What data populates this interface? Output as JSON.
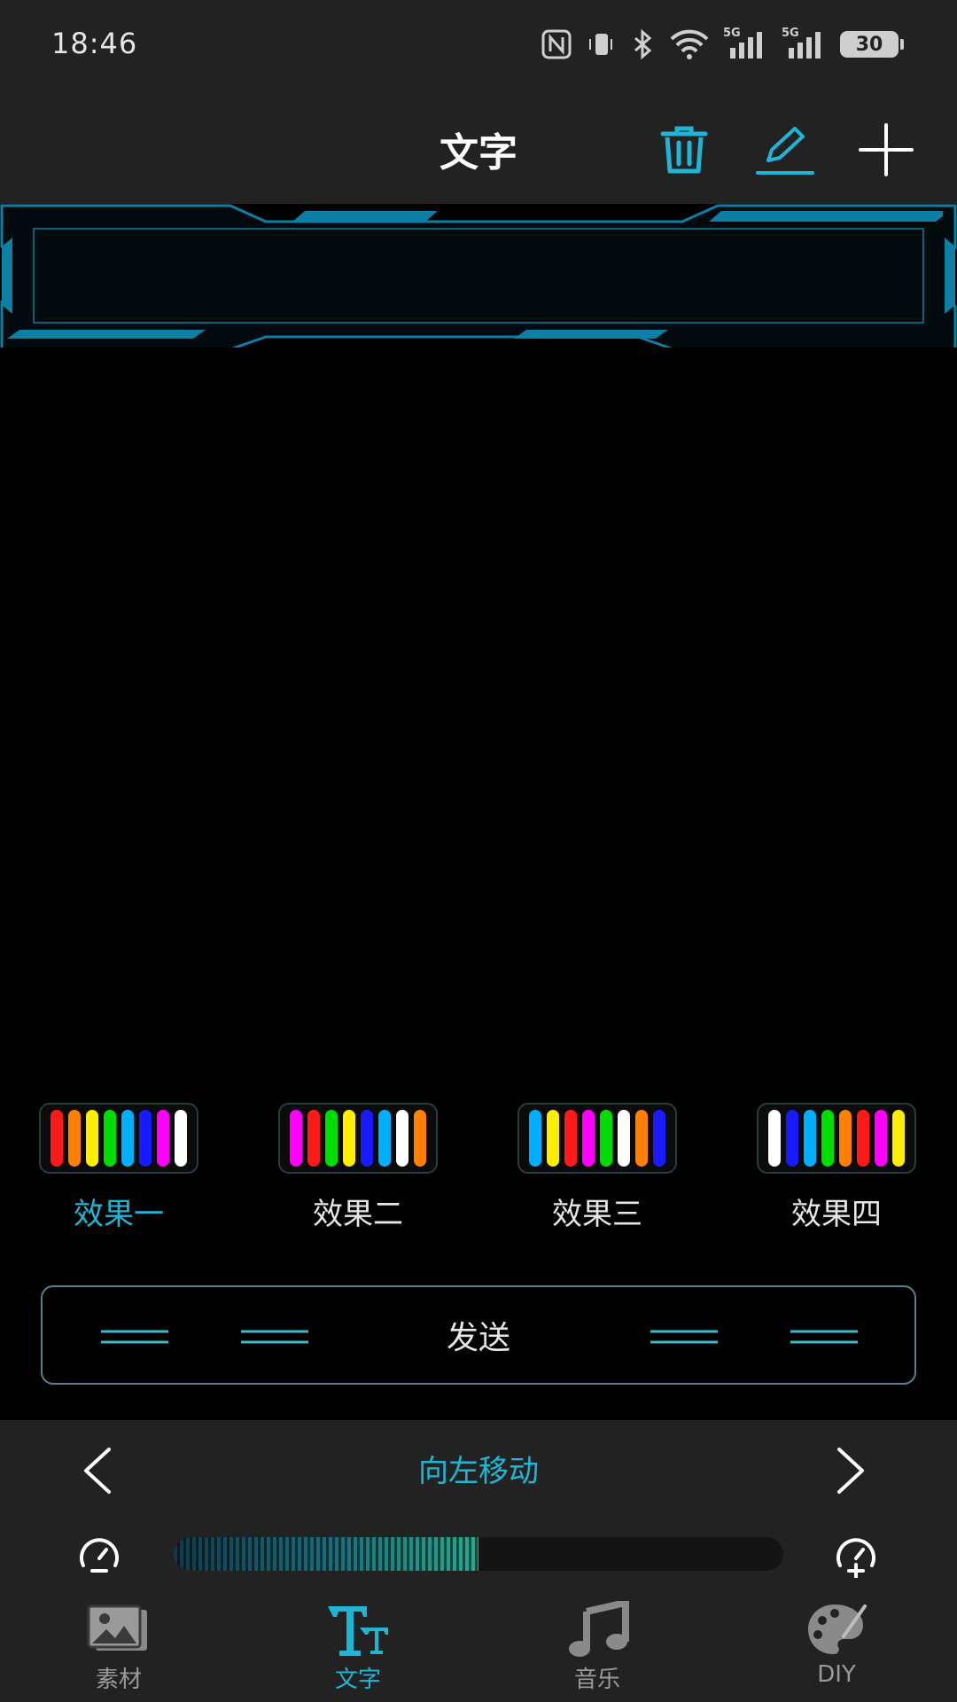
{
  "status_bar": {
    "time": "18:46",
    "network_1": "5G",
    "network_2": "5G",
    "battery": "30"
  },
  "header": {
    "title": "文字",
    "actions": [
      "trash-icon",
      "edit-icon",
      "plus-icon"
    ],
    "accent_color": "#1fb6d6"
  },
  "preview": {
    "text": ""
  },
  "effects": {
    "selected_index": 0,
    "items": [
      {
        "label": "效果一",
        "colors": [
          "#ff1a1a",
          "#ff7f00",
          "#ffee00",
          "#00dd00",
          "#00b0ff",
          "#1a1aff",
          "#ff00ff",
          "#ffffff"
        ]
      },
      {
        "label": "效果二",
        "colors": [
          "#ff00ff",
          "#ff1a1a",
          "#00dd00",
          "#ffee00",
          "#1a1aff",
          "#00b0ff",
          "#ffffff",
          "#ff7f00"
        ]
      },
      {
        "label": "效果三",
        "colors": [
          "#00b0ff",
          "#ffee00",
          "#ff1a1a",
          "#ff00ff",
          "#00dd00",
          "#ffffff",
          "#ff7f00",
          "#1a1aff"
        ]
      },
      {
        "label": "效果四",
        "colors": [
          "#ffffff",
          "#1a1aff",
          "#00b0ff",
          "#00dd00",
          "#ff7f00",
          "#ff1a1a",
          "#ff00ff",
          "#ffee00"
        ]
      }
    ]
  },
  "send": {
    "label": "发送"
  },
  "control": {
    "mode_label": "向左移动",
    "speed_fraction": 0.5
  },
  "tabs": [
    {
      "label": "素材",
      "icon": "image-icon",
      "active": false
    },
    {
      "label": "文字",
      "icon": "text-icon",
      "active": true
    },
    {
      "label": "音乐",
      "icon": "music-icon",
      "active": false
    },
    {
      "label": "DIY",
      "icon": "palette-icon",
      "active": false
    }
  ]
}
